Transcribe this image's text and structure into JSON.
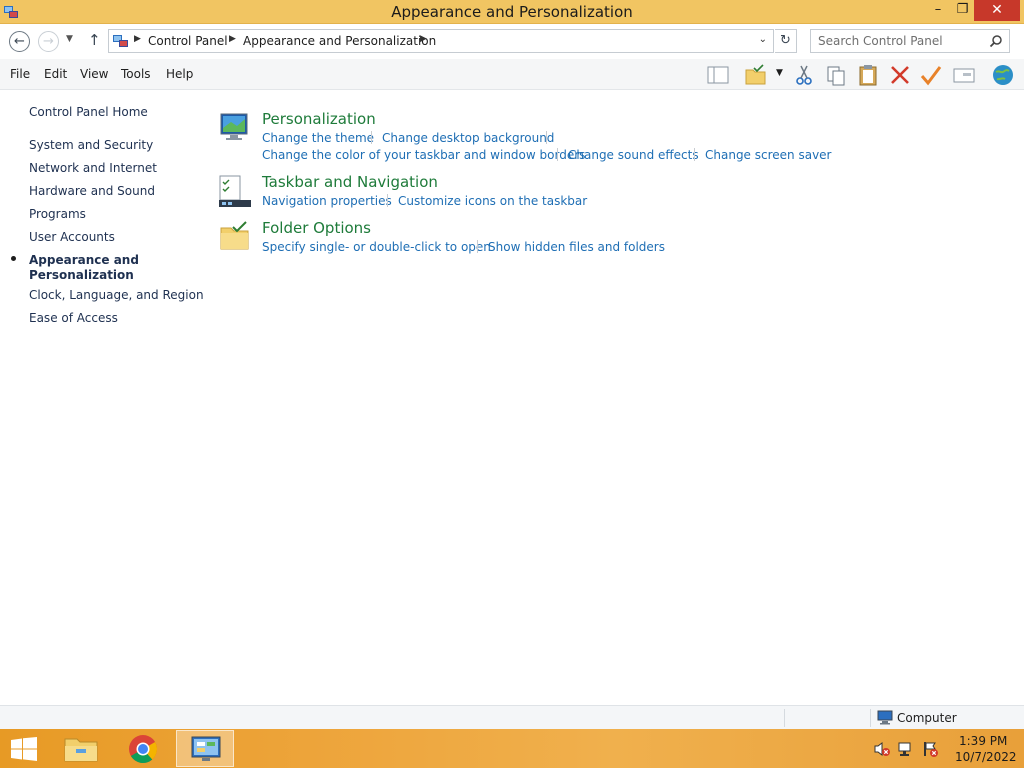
{
  "window": {
    "title": "Appearance and Personalization",
    "minimize_glyph": "–",
    "restore_glyph": "❐",
    "close_glyph": "✕"
  },
  "address": {
    "crumbs": [
      "Control Panel",
      "Appearance and Personalization"
    ],
    "search_placeholder": "Search Control Panel"
  },
  "menu": [
    "File",
    "Edit",
    "View",
    "Tools",
    "Help"
  ],
  "nav": {
    "home": "Control Panel Home",
    "items": [
      "System and Security",
      "Network and Internet",
      "Hardware and Sound",
      "Programs",
      "User Accounts",
      "Appearance and Personalization",
      "Clock, Language, and Region",
      "Ease of Access"
    ]
  },
  "categories": [
    {
      "title": "Personalization",
      "links": [
        "Change the theme",
        "Change desktop background",
        "Change the color of your taskbar and window borders",
        "Change sound effects",
        "Change screen saver"
      ]
    },
    {
      "title": "Taskbar and Navigation",
      "links": [
        "Navigation properties",
        "Customize icons on the taskbar"
      ]
    },
    {
      "title": "Folder Options",
      "links": [
        "Specify single- or double-click to open",
        "Show hidden files and folders"
      ]
    }
  ],
  "status": {
    "text": "Computer"
  },
  "clock": {
    "time": "1:39 PM",
    "date": "10/7/2022"
  },
  "colors": {
    "titlebar": "#f1c562",
    "close": "#c7382a",
    "link": "#1e6eb4",
    "heading": "#1e7b3a",
    "taskbar": "#eda43a"
  }
}
